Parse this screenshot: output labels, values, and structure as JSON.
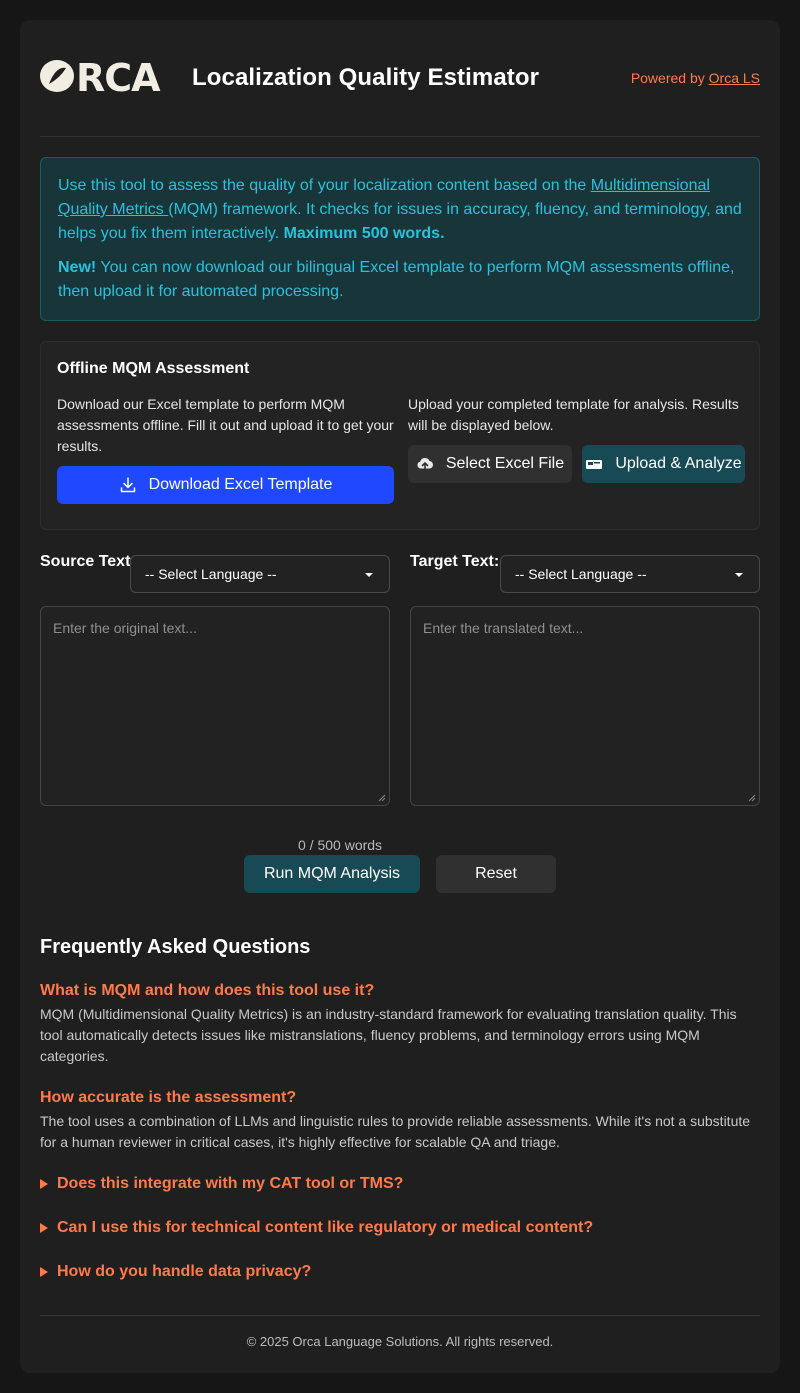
{
  "header": {
    "logo_text": "ORCA",
    "title": "Localization Quality Estimator",
    "powered_prefix": "Powered by ",
    "powered_link": "Orca LS"
  },
  "info": {
    "p1_before": "Use this tool to assess the quality of your localization content based on the ",
    "p1_link": "Multidimensional Quality Metrics ",
    "p1_after": "(MQM) framework. It checks for issues in accuracy, fluency, and terminology, and helps you fix them interactively. ",
    "p1_bold": "Maximum 500 words.",
    "p2_bold": "New!",
    "p2_text": " You can now download our bilingual Excel template to perform MQM assessments offline, then upload it for automated processing."
  },
  "offline": {
    "title": "Offline MQM Assessment",
    "left_text": "Download our Excel template to perform MQM assessments offline. Fill it out and upload it to get your results.",
    "right_text": "Upload your completed template for analysis. Results will be displayed below.",
    "download_label": "Download Excel Template",
    "select_label": "Select Excel File",
    "upload_label": "Upload & Analyze"
  },
  "source": {
    "label": "Source Text:",
    "select_value": "-- Select Language --",
    "placeholder": "Enter the original text..."
  },
  "target": {
    "label": "Target Text:",
    "select_value": "-- Select Language --",
    "placeholder": "Enter the translated text..."
  },
  "word_count": "0 / 500 words",
  "actions": {
    "run_label": "Run MQM Analysis",
    "reset_label": "Reset"
  },
  "faq": {
    "title": "Frequently Asked Questions",
    "open": [
      {
        "q": "What is MQM and how does this tool use it?",
        "a": "MQM (Multidimensional Quality Metrics) is an industry-standard framework for evaluating translation quality. This tool automatically detects issues like mistranslations, fluency problems, and terminology errors using MQM categories."
      },
      {
        "q": "How accurate is the assessment?",
        "a": "The tool uses a combination of LLMs and linguistic rules to provide reliable assessments. While it's not a substitute for a human reviewer in critical cases, it's highly effective for scalable QA and triage."
      }
    ],
    "collapsed": [
      "Does this integrate with my CAT tool or TMS?",
      "Can I use this for technical content like regulatory or medical content?",
      "How do you handle data privacy?"
    ]
  },
  "footer": "© 2025 Orca Language Solutions. All rights reserved.",
  "colors": {
    "accent_orange": "#ff7a4a",
    "info_cyan": "#2bc0db",
    "primary_blue": "#1f48ff",
    "teal_button": "#174a55"
  }
}
